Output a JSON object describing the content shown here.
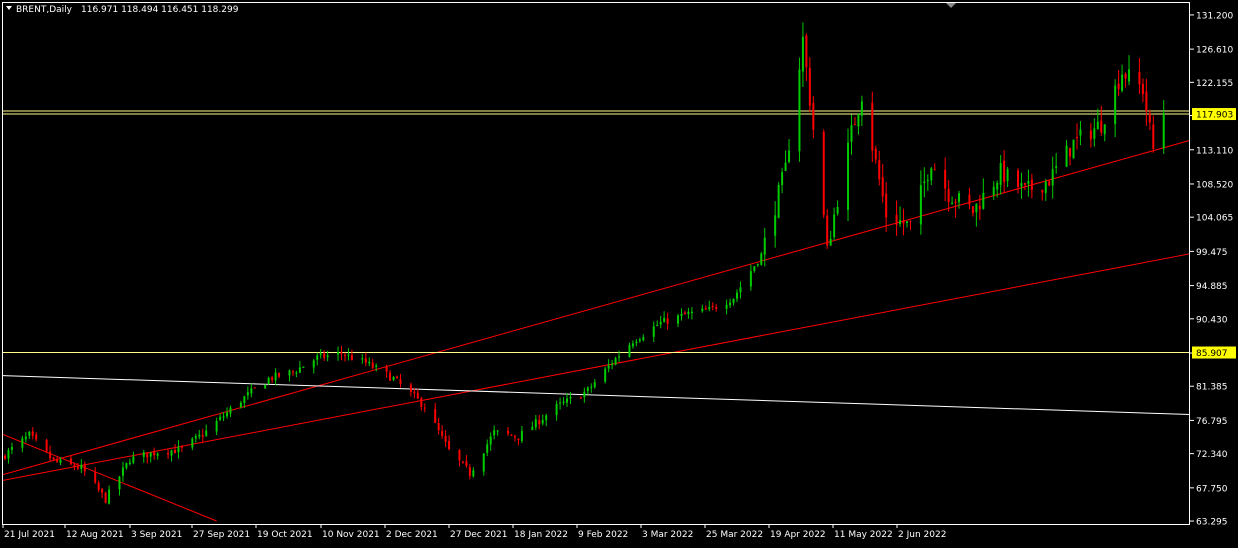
{
  "window": {
    "symbol_caption": "BRENT,Daily",
    "ohlc_caption": "116.971 118.494 116.451 118.299"
  },
  "colors": {
    "background": "#000000",
    "frame": "#ffffff",
    "bull_candle": "#00cc00",
    "bear_candle": "#ff0000",
    "horizontal_line": "#ffff88",
    "price_label_bg": "#ffff00",
    "trend_red": "#ff0000",
    "trend_white": "#ffffff"
  },
  "chart_data": {
    "type": "candlestick",
    "symbol": "BRENT",
    "timeframe": "Daily",
    "y_ticks": [
      131.2,
      126.61,
      122.155,
      117.7,
      113.11,
      108.52,
      104.065,
      99.475,
      94.885,
      90.43,
      85.84,
      81.385,
      76.795,
      72.34,
      67.75,
      63.295
    ],
    "y_tick_labels": [
      "131.200",
      "126.610",
      "122.155",
      "117.903",
      "113.110",
      "108.520",
      "104.065",
      "99.475",
      "94.885",
      "90.430",
      "85.907",
      "81.385",
      "76.795",
      "72.340",
      "67.750",
      "63.295"
    ],
    "ylim": [
      62.9,
      132.8
    ],
    "x_labels": [
      "21 Jul 2021",
      "12 Aug 2021",
      "3 Sep 2021",
      "27 Sep 2021",
      "19 Oct 2021",
      "10 Nov 2021",
      "2 Dec 2021",
      "27 Dec 2021",
      "18 Jan 2022",
      "9 Feb 2022",
      "3 Mar 2022",
      "25 Mar 2022",
      "19 Apr 2022",
      "11 May 2022",
      "2 Jun 2022"
    ],
    "horizontal_lines": [
      {
        "price": 117.903,
        "label": "117.903"
      },
      {
        "price": 85.907,
        "label": "85.907"
      }
    ],
    "trend_lines": [
      {
        "color": "red",
        "from": {
          "date": "2021-07-21",
          "price": 69.6
        },
        "to": {
          "date": "2022-06-27",
          "price": 114.3
        }
      },
      {
        "color": "red",
        "from": {
          "date": "2021-07-21",
          "price": 68.8
        },
        "to": {
          "date": "2022-06-27",
          "price": 99.1
        }
      },
      {
        "color": "red",
        "from": {
          "date": "2021-07-21",
          "price": 74.8
        },
        "to": {
          "date": "2021-09-20",
          "price": 63.3
        }
      },
      {
        "color": "white",
        "from": {
          "date": "2021-07-21",
          "price": 82.8
        },
        "to": {
          "date": "2022-06-27",
          "price": 77.6
        }
      }
    ],
    "ohlc_close_path": [
      [
        "2021-07-21",
        72.2
      ],
      [
        "2021-07-28",
        74.8
      ],
      [
        "2021-08-04",
        71.3
      ],
      [
        "2021-08-12",
        70.4
      ],
      [
        "2021-08-19",
        66.2
      ],
      [
        "2021-08-26",
        71.6
      ],
      [
        "2021-09-03",
        72.6
      ],
      [
        "2021-09-10",
        72.9
      ],
      [
        "2021-09-17",
        75.3
      ],
      [
        "2021-09-27",
        79.5
      ],
      [
        "2021-10-05",
        82.4
      ],
      [
        "2021-10-12",
        83.3
      ],
      [
        "2021-10-19",
        85.2
      ],
      [
        "2021-10-26",
        85.8
      ],
      [
        "2021-11-02",
        84.5
      ],
      [
        "2021-11-10",
        82.4
      ],
      [
        "2021-11-19",
        78.7
      ],
      [
        "2021-11-26",
        72.7
      ],
      [
        "2021-12-02",
        69.7
      ],
      [
        "2021-12-09",
        75.2
      ],
      [
        "2021-12-16",
        74.6
      ],
      [
        "2021-12-27",
        78.6
      ],
      [
        "2022-01-05",
        80.8
      ],
      [
        "2022-01-12",
        84.6
      ],
      [
        "2022-01-18",
        87.5
      ],
      [
        "2022-01-26",
        89.9
      ],
      [
        "2022-02-03",
        91.1
      ],
      [
        "2022-02-09",
        91.6
      ],
      [
        "2022-02-16",
        93.3
      ],
      [
        "2022-02-24",
        99.0
      ],
      [
        "2022-03-03",
        110.5
      ],
      [
        "2022-03-08",
        127.9
      ],
      [
        "2022-03-15",
        99.9
      ],
      [
        "2022-03-22",
        115.4
      ],
      [
        "2022-03-25",
        120.6
      ],
      [
        "2022-04-01",
        104.4
      ],
      [
        "2022-04-08",
        102.8
      ],
      [
        "2022-04-14",
        111.7
      ],
      [
        "2022-04-19",
        107.3
      ],
      [
        "2022-04-26",
        104.9
      ],
      [
        "2022-05-04",
        110.1
      ],
      [
        "2022-05-11",
        107.5
      ],
      [
        "2022-05-18",
        109.1
      ],
      [
        "2022-05-25",
        114.0
      ],
      [
        "2022-06-02",
        116.6
      ],
      [
        "2022-06-08",
        123.6
      ],
      [
        "2022-06-14",
        121.2
      ],
      [
        "2022-06-17",
        113.1
      ],
      [
        "2022-06-20",
        118.3
      ]
    ]
  }
}
